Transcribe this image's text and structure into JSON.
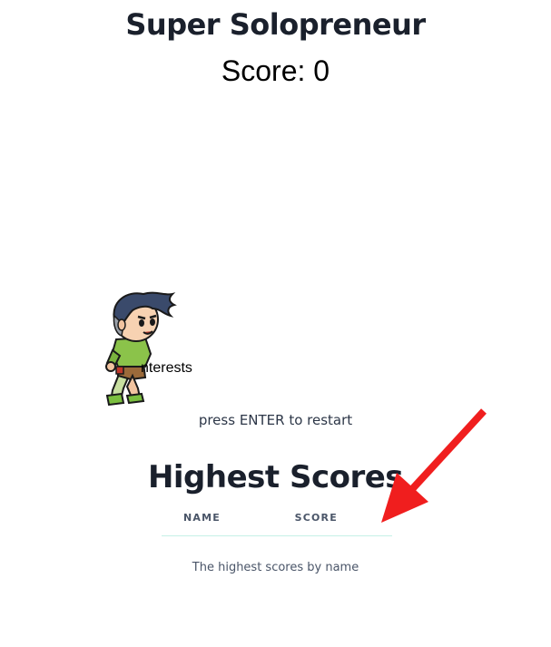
{
  "game": {
    "title": "Super Solopreneur",
    "score_text": "Score: 0",
    "obstacle_label": "nterests",
    "restart_hint": "press ENTER to restart"
  },
  "leaderboard": {
    "heading": "Highest Scores",
    "columns": [
      "NAME",
      "SCORE"
    ],
    "caption": "The highest scores by name"
  },
  "icons": {
    "player": "running-boy-sprite-icon",
    "annotation": "red-arrow-icon"
  },
  "colors": {
    "annotation_arrow": "#f01e1e",
    "table_divider": "#c6f0e6"
  }
}
